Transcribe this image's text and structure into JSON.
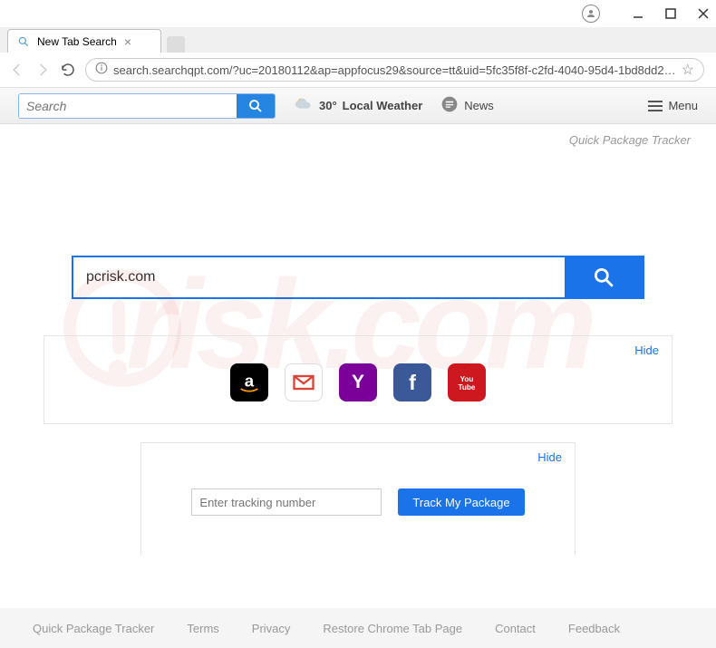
{
  "window": {
    "tab_title": "New Tab Search",
    "url_display": "search.searchqpt.com/?uc=20180112&ap=appfocus29&source=tt&uid=5fc35f8f-c2fd-4040-95d4-1bd8dd2…"
  },
  "toolbar": {
    "search_placeholder": "Search",
    "weather_temp": "30°",
    "weather_label": "Local Weather",
    "news_label": "News",
    "menu_label": "Menu"
  },
  "brand": "Quick Package Tracker",
  "main_search": {
    "value": "pcrisk.com"
  },
  "quicklinks": {
    "hide_label": "Hide",
    "items": [
      {
        "name": "amazon"
      },
      {
        "name": "gmail"
      },
      {
        "name": "yahoo"
      },
      {
        "name": "facebook"
      },
      {
        "name": "youtube"
      }
    ]
  },
  "tracking": {
    "hide_label": "Hide",
    "placeholder": "Enter tracking number",
    "button_label": "Track My Package"
  },
  "footer": {
    "links": [
      "Quick Package Tracker",
      "Terms",
      "Privacy",
      "Restore Chrome Tab Page",
      "Contact",
      "Feedback"
    ]
  }
}
